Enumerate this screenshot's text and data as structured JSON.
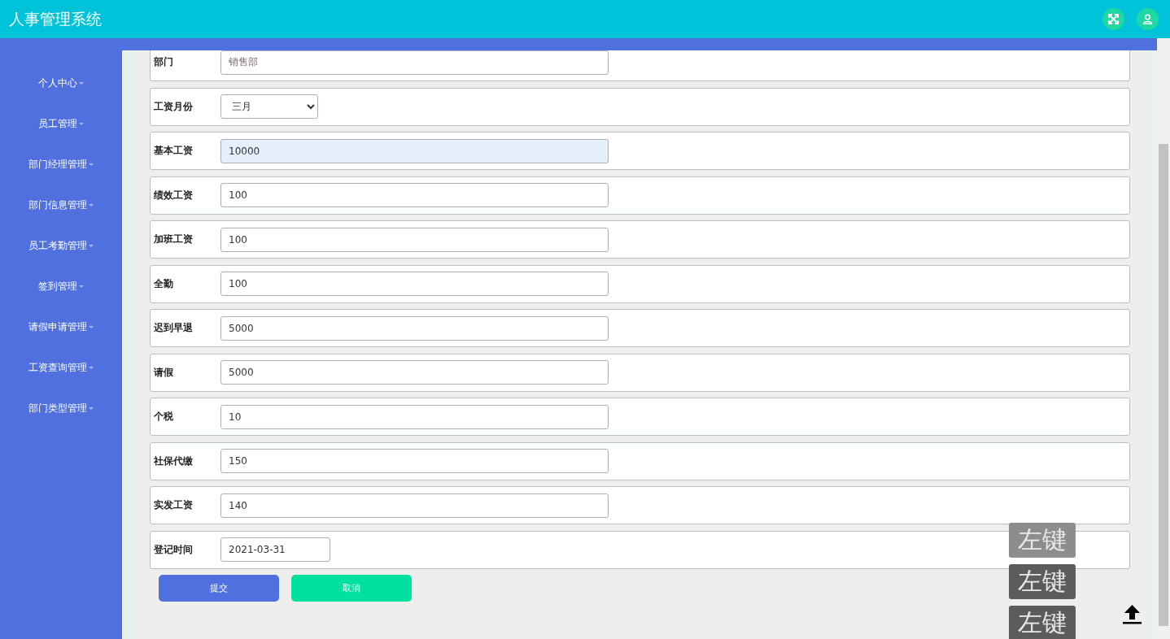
{
  "header": {
    "title": "人事管理系统"
  },
  "sidebar": {
    "items": [
      {
        "label": "个人中心"
      },
      {
        "label": "员工管理"
      },
      {
        "label": "部门经理管理"
      },
      {
        "label": "部门信息管理"
      },
      {
        "label": "员工考勤管理"
      },
      {
        "label": "签到管理"
      },
      {
        "label": "请假申请管理"
      },
      {
        "label": "工资查询管理"
      },
      {
        "label": "部门类型管理"
      }
    ]
  },
  "form": {
    "fields": [
      {
        "kind": "text",
        "label": "部门",
        "value": "销售部",
        "readonly": true,
        "focused": false
      },
      {
        "kind": "select",
        "label": "工资月份",
        "value": "三月",
        "readonly": false,
        "focused": false
      },
      {
        "kind": "text",
        "label": "基本工资",
        "value": "10000",
        "readonly": false,
        "focused": true
      },
      {
        "kind": "text",
        "label": "绩效工资",
        "value": "100",
        "readonly": false,
        "focused": false
      },
      {
        "kind": "text",
        "label": "加班工资",
        "value": "100",
        "readonly": false,
        "focused": false
      },
      {
        "kind": "text",
        "label": "全勤",
        "value": "100",
        "readonly": false,
        "focused": false
      },
      {
        "kind": "text",
        "label": "迟到早退",
        "value": "5000",
        "readonly": false,
        "focused": false
      },
      {
        "kind": "text",
        "label": "请假",
        "value": "5000",
        "readonly": false,
        "focused": false
      },
      {
        "kind": "text",
        "label": "个税",
        "value": "10",
        "readonly": false,
        "focused": false
      },
      {
        "kind": "text",
        "label": "社保代缴",
        "value": "150",
        "readonly": false,
        "focused": false
      },
      {
        "kind": "text",
        "label": "实发工资",
        "value": "140",
        "readonly": false,
        "focused": false
      },
      {
        "kind": "date",
        "label": "登记时间",
        "value": "2021-03-31",
        "readonly": false,
        "focused": false
      }
    ],
    "buttons": [
      {
        "kind": "submit",
        "label": "提交"
      },
      {
        "kind": "cancel",
        "label": "取消"
      }
    ]
  },
  "key_overlays": [
    {
      "label": "左键",
      "faded": true
    },
    {
      "label": "左键",
      "faded": false
    },
    {
      "label": "左键",
      "faded": false
    }
  ]
}
